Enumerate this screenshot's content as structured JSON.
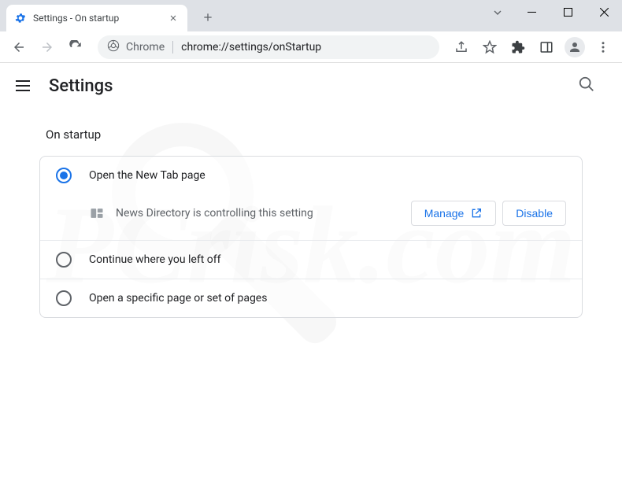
{
  "tab": {
    "title": "Settings - On startup"
  },
  "omnibox": {
    "chip": "Chrome",
    "url": "chrome://settings/onStartup"
  },
  "header": {
    "title": "Settings"
  },
  "section": {
    "title": "On startup"
  },
  "options": {
    "opt1": "Open the New Tab page",
    "controlled_by": "News Directory is controlling this setting",
    "manage_btn": "Manage",
    "disable_btn": "Disable",
    "opt2": "Continue where you left off",
    "opt3": "Open a specific page or set of pages"
  }
}
